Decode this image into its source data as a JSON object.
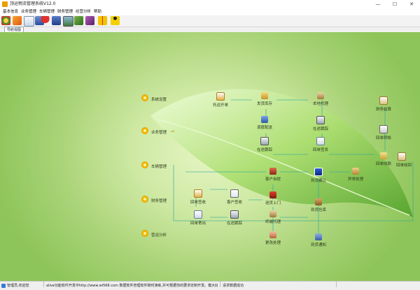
{
  "window": {
    "title": "顶运物流管理系统V12.0",
    "minimize": "—",
    "maximize": "☐",
    "close": "✕"
  },
  "menu": [
    "基本信息",
    "业务管理",
    "车辆管理",
    "财务管理",
    "经营分析",
    "帮助"
  ],
  "toolbar_icons": [
    "color-gear-icon",
    "arrow-orange-icon",
    "document-pen-icon",
    "people-icon",
    "umbrella-icon",
    "users-group-icon",
    "picture-icon",
    "book-green-icon",
    "book-purple-icon",
    "gift-box-icon",
    "runner-icon"
  ],
  "tab": {
    "label": "导航视图"
  },
  "modules": [
    "系统设置",
    "业务管理",
    "车辆管理",
    "财务管理",
    "营运分析"
  ],
  "nodes": {
    "tuoyun": "托运开单",
    "fahuo": "发货库存",
    "bendi": "本地代理",
    "caiwu": "财务结算",
    "diaodu": "调度配送",
    "zaitu1": "在途跟踪",
    "zaitu2": "在途跟踪",
    "huidanfengfa": "回单签发",
    "huidanzhuan": "回单转帐",
    "huidanzhuijia": "回单收款",
    "kehu": "客户自提",
    "daoda": "到货确认",
    "yichang": "异常处理",
    "huidanfankui": "回单签收",
    "kehuqianshou": "客户签收",
    "songhuo": "送货上门",
    "daohuo_cang": "到货仓库",
    "huidan_tuo": "回单寄出",
    "zaitu3": "在途跟踪",
    "zhongzhuan": "终端代理",
    "daohuo_tong": "到货通知",
    "gengzheng": "更改处理",
    "huidan_right": "回单收回"
  },
  "status": {
    "user": "管理员,欢迎您",
    "info": "alive功能软件开发中http://www.wl568.com 数据软件管理软件随时演练,并可根据你的要求定制开发。模大好!",
    "connect": "请求数据成功"
  }
}
